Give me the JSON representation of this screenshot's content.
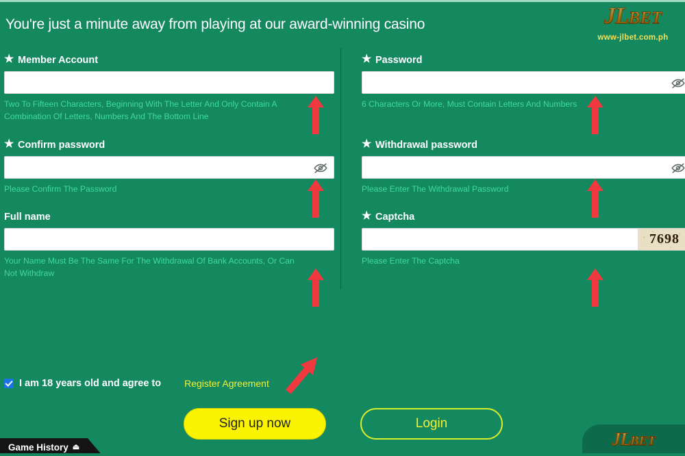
{
  "header": {
    "headline": "You're just a minute away from playing at our award-winning casino",
    "logo_main": "JL",
    "logo_sub": "BET",
    "logo_url": "www-jlbet.com.ph"
  },
  "form": {
    "left": [
      {
        "label": "Member Account",
        "required_star": "★",
        "value": "",
        "placeholder": "",
        "hint": "Two To Fifteen Characters, Beginning With The Letter And Only Contain A Combination Of Letters, Numbers And The Bottom Line",
        "has_eye": false
      },
      {
        "label": "Confirm password",
        "required_star": "★",
        "value": "",
        "placeholder": "",
        "hint": "Please Confirm The Password",
        "has_eye": true
      },
      {
        "label": "Full name",
        "required_star": "",
        "value": "",
        "placeholder": "",
        "hint": "Your Name Must Be The Same For The Withdrawal Of Bank Accounts, Or Can Not Withdraw",
        "has_eye": false
      }
    ],
    "right": [
      {
        "label": "Password",
        "required_star": "★",
        "value": "",
        "placeholder": "",
        "hint": "6 Characters Or More, Must Contain Letters And Numbers",
        "has_eye": true
      },
      {
        "label": "Withdrawal password",
        "required_star": "★",
        "value": "",
        "placeholder": "",
        "hint": "Please Enter The Withdrawal Password",
        "has_eye": true
      },
      {
        "label": "Captcha",
        "required_star": "★",
        "value": "",
        "placeholder": "",
        "hint": "Please Enter The Captcha",
        "has_eye": false,
        "captcha_code": "7698"
      }
    ]
  },
  "agreement": {
    "checked": true,
    "text": "I am 18 years old and agree to",
    "link": "Register Agreement"
  },
  "actions": {
    "signup_label": "Sign up now",
    "login_label": "Login"
  },
  "footer": {
    "game_history_label": "Game History",
    "game_history_icon": "⏏",
    "brand_main": "JL",
    "brand_sub": "BET"
  },
  "annotations": {
    "arrow_color": "#f0383f",
    "arrow_count_up": 6,
    "arrow_count_diagonal": 1
  },
  "colors": {
    "background_green": "#14885e",
    "hint_green": "#3fdb9e",
    "accent_yellow": "#fbf400",
    "link_yellow": "#f2f23a",
    "checkbox_blue": "#1a73e8",
    "divider": "#0d5c41",
    "captcha_bg": "#e8dfc4",
    "brand_panel": "#0d6b4b"
  }
}
